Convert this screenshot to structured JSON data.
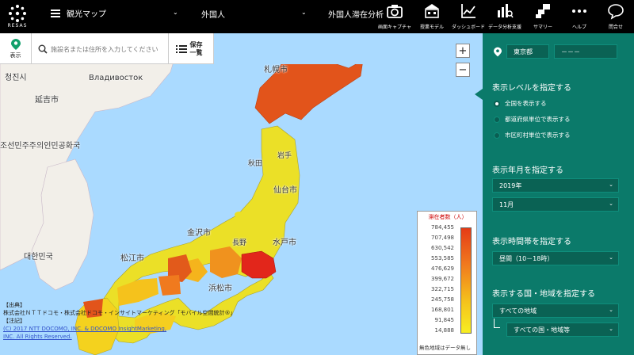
{
  "app": {
    "logo_text": "RESAS"
  },
  "topbar": {
    "menu_label": "観光マップ",
    "dropdown1": "外国人",
    "dropdown2": "外国人滞在分析",
    "tools": [
      {
        "label": "画面キャプチャ",
        "icon": "camera-icon"
      },
      {
        "label": "授業モデル",
        "icon": "school-icon"
      },
      {
        "label": "ダッシュボード",
        "icon": "dashboard-icon"
      },
      {
        "label": "データ分析支援",
        "icon": "data-analysis-icon"
      },
      {
        "label": "サマリー",
        "icon": "summary-icon"
      },
      {
        "label": "ヘルプ",
        "icon": "help-icon"
      },
      {
        "label": "問合せ",
        "icon": "chat-icon"
      }
    ]
  },
  "subbar": {
    "show_label": "表示",
    "search_placeholder": "施設名または住所を入力してください",
    "save_label": "保存一覧"
  },
  "panel": {
    "prefecture": "東京都",
    "city": "－－－",
    "level_title": "表示レベルを指定する",
    "level_options": [
      "全国を表示する",
      "都道府県単位で表示する",
      "市区町村単位で表示する"
    ],
    "selected_level": 0,
    "period_title": "表示年月を指定する",
    "year": "2019年",
    "month": "11月",
    "time_title": "表示時間帯を指定する",
    "time": "昼間（10－18時）",
    "region_title": "表示する国・地域を指定する",
    "region": "すべての地域",
    "country": "すべての国・地域等"
  },
  "map": {
    "labels": [
      "Владивосток",
      "延吉市",
      "청진시",
      "조선민주주의인민공화국",
      "대한민국",
      "札幌市",
      "仙台市",
      "水戸市",
      "金沢市",
      "松江市",
      "浜松市",
      "秋田",
      "長野",
      "岩手"
    ],
    "colors": {
      "sea": "#aadaff",
      "land": "#f2efe9",
      "high": "#e53b16",
      "mid": "#f07a1e",
      "low": "#f7ee22"
    }
  },
  "legend": {
    "title": "滞在者数（人）",
    "ticks": [
      "784,455",
      "707,498",
      "630,542",
      "553,585",
      "476,629",
      "399,672",
      "322,715",
      "245,758",
      "168,801",
      "91,845",
      "14,888"
    ],
    "no_data": "無色地域はデータ無し",
    "scale": "200km"
  },
  "credit": {
    "lines": [
      "【出典】",
      "株式会社ＮＴＴドコモ・株式会社ドコモ・インサイトマーケティング「モバイル空間統計®」",
      "【注記】"
    ],
    "links": [
      "(C) 2017 NTT DOCOMO, INC. & DOCOMO InsightMarketing,",
      "INC. All Rights Reserved."
    ]
  }
}
